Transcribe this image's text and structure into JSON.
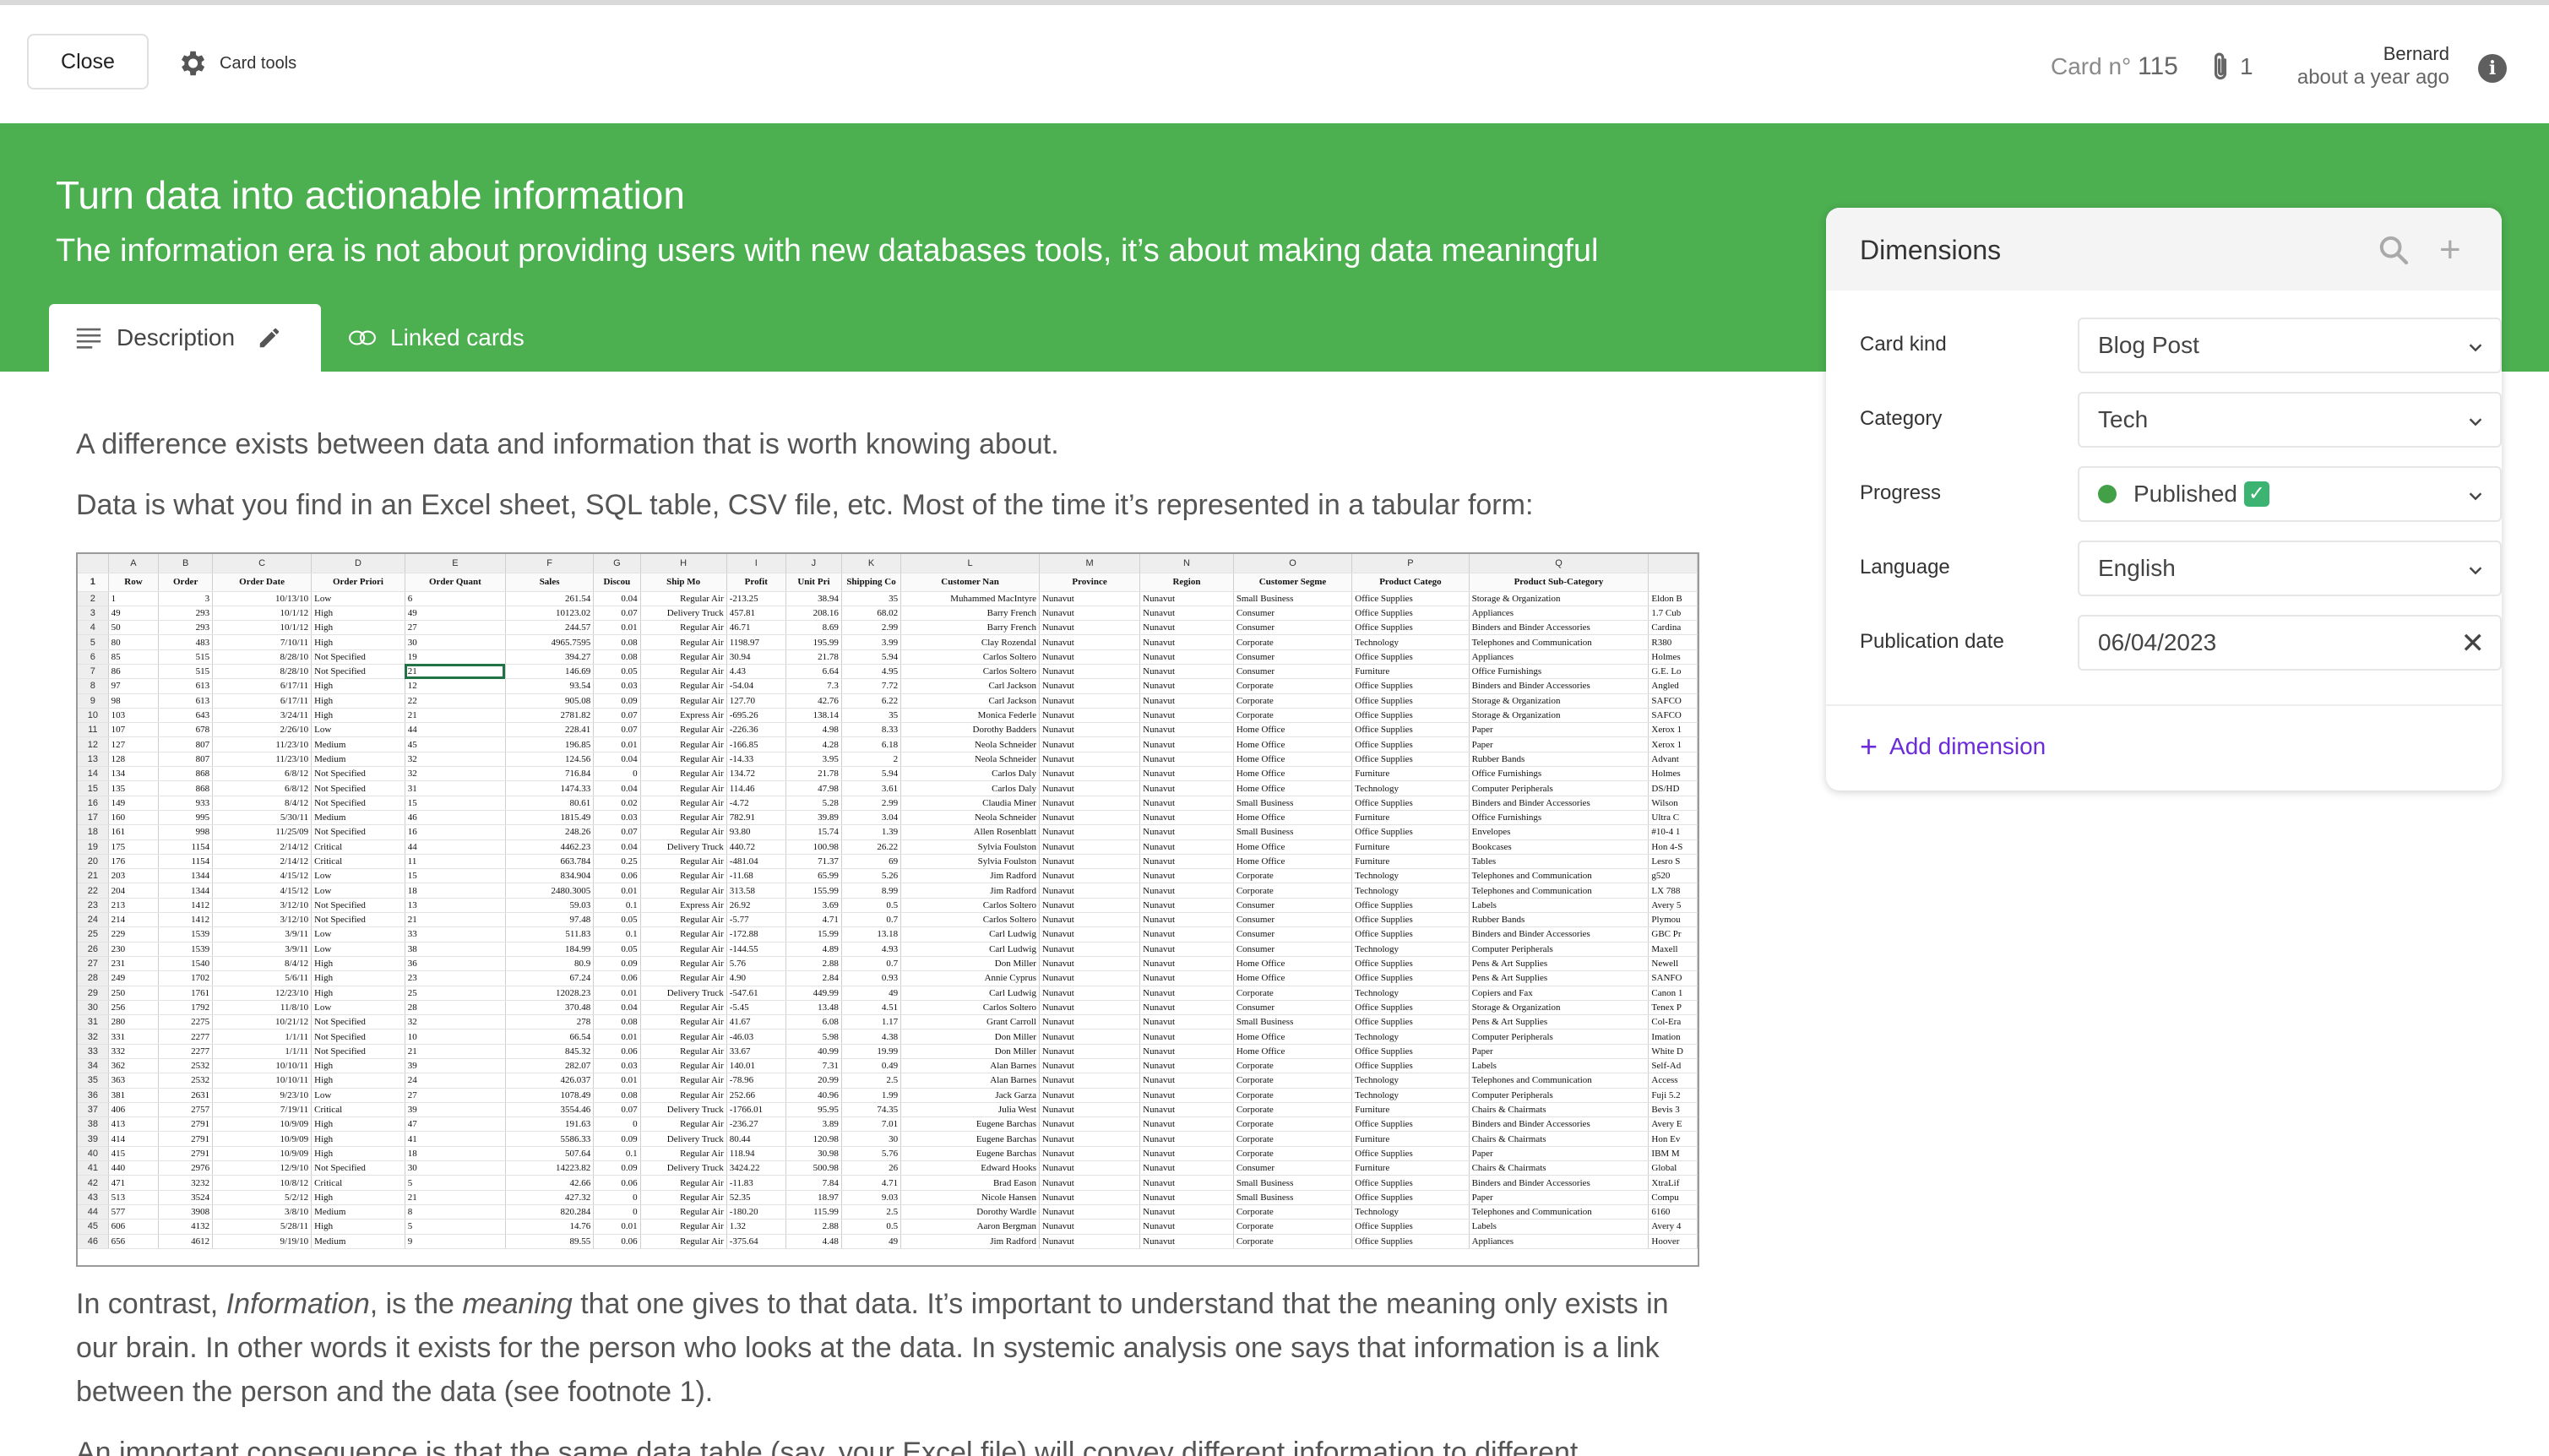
{
  "topbar": {
    "close_label": "Close",
    "card_tools_label": "Card tools",
    "card_number_label": "Card n°",
    "card_number": "115",
    "attachments_count": "1",
    "author": "Bernard",
    "updated": "about a year ago"
  },
  "hero": {
    "title": "Turn data into actionable information",
    "subtitle": "The information era is not about providing users with new databases tools, it’s about making data meaningful",
    "tabs": {
      "description": "Description",
      "linked": "Linked cards"
    },
    "bg_color": "#4caf50"
  },
  "content": {
    "p1": "A difference exists between data and information that is worth knowing about.",
    "p2": "Data is what you find in an Excel sheet, SQL table, CSV file, etc. Most of the time it’s represented in a tabular form:",
    "p3_a": "In contrast, ",
    "p3_b": "Information",
    "p3_c": ", is the ",
    "p3_d": "meaning",
    "p3_e": " that one gives to that data. It’s important to understand that the meaning only exists in our brain. In other words it exists for the person who looks at the data. In systemic analysis one says that information is a link between the person and the data (see footnote 1).",
    "p4": "An important consequence is that the same data table (say, your Excel file) will convey different information to different"
  },
  "spreadsheet": {
    "columns": [
      "A",
      "B",
      "C",
      "D",
      "E",
      "F",
      "G",
      "H",
      "I",
      "J",
      "K",
      "L",
      "M",
      "N",
      "O",
      "P",
      "Q",
      ""
    ],
    "fields": [
      "Row",
      "Order",
      "Order Date",
      "Order Priori",
      "Order Quant",
      "Sales",
      "Discou",
      "Ship Mo",
      "Profit",
      "Unit Pri",
      "Shipping Co",
      "Customer Nan",
      "Province",
      "Region",
      "Customer Segme",
      "Product Catego",
      "Product Sub-Category",
      ""
    ],
    "rows": [
      [
        "1",
        "3",
        "10/13/10",
        "Low",
        "6",
        "261.54",
        "0.04",
        "Regular Air",
        "-213.25",
        "38.94",
        "35",
        "Muhammed MacIntyre",
        "Nunavut",
        "Nunavut",
        "Small Business",
        "Office Supplies",
        "Storage & Organization",
        "Eldon B"
      ],
      [
        "49",
        "293",
        "10/1/12",
        "High",
        "49",
        "10123.02",
        "0.07",
        "Delivery Truck",
        "457.81",
        "208.16",
        "68.02",
        "Barry French",
        "Nunavut",
        "Nunavut",
        "Consumer",
        "Office Supplies",
        "Appliances",
        "1.7 Cub"
      ],
      [
        "50",
        "293",
        "10/1/12",
        "High",
        "27",
        "244.57",
        "0.01",
        "Regular Air",
        "46.71",
        "8.69",
        "2.99",
        "Barry French",
        "Nunavut",
        "Nunavut",
        "Consumer",
        "Office Supplies",
        "Binders and Binder Accessories",
        "Cardina"
      ],
      [
        "80",
        "483",
        "7/10/11",
        "High",
        "30",
        "4965.7595",
        "0.08",
        "Regular Air",
        "1198.97",
        "195.99",
        "3.99",
        "Clay Rozendal",
        "Nunavut",
        "Nunavut",
        "Corporate",
        "Technology",
        "Telephones and Communication",
        "R380"
      ],
      [
        "85",
        "515",
        "8/28/10",
        "Not Specified",
        "19",
        "394.27",
        "0.08",
        "Regular Air",
        "30.94",
        "21.78",
        "5.94",
        "Carlos Soltero",
        "Nunavut",
        "Nunavut",
        "Consumer",
        "Office Supplies",
        "Appliances",
        "Holmes"
      ],
      [
        "86",
        "515",
        "8/28/10",
        "Not Specified",
        "21",
        "146.69",
        "0.05",
        "Regular Air",
        "4.43",
        "6.64",
        "4.95",
        "Carlos Soltero",
        "Nunavut",
        "Nunavut",
        "Consumer",
        "Furniture",
        "Office Furnishings",
        "G.E. Lo"
      ],
      [
        "97",
        "613",
        "6/17/11",
        "High",
        "12",
        "93.54",
        "0.03",
        "Regular Air",
        "-54.04",
        "7.3",
        "7.72",
        "Carl Jackson",
        "Nunavut",
        "Nunavut",
        "Corporate",
        "Office Supplies",
        "Binders and Binder Accessories",
        "Angled"
      ],
      [
        "98",
        "613",
        "6/17/11",
        "High",
        "22",
        "905.08",
        "0.09",
        "Regular Air",
        "127.70",
        "42.76",
        "6.22",
        "Carl Jackson",
        "Nunavut",
        "Nunavut",
        "Corporate",
        "Office Supplies",
        "Storage & Organization",
        "SAFCO"
      ],
      [
        "103",
        "643",
        "3/24/11",
        "High",
        "21",
        "2781.82",
        "0.07",
        "Express Air",
        "-695.26",
        "138.14",
        "35",
        "Monica Federle",
        "Nunavut",
        "Nunavut",
        "Corporate",
        "Office Supplies",
        "Storage & Organization",
        "SAFCO"
      ],
      [
        "107",
        "678",
        "2/26/10",
        "Low",
        "44",
        "228.41",
        "0.07",
        "Regular Air",
        "-226.36",
        "4.98",
        "8.33",
        "Dorothy Badders",
        "Nunavut",
        "Nunavut",
        "Home Office",
        "Office Supplies",
        "Paper",
        "Xerox 1"
      ],
      [
        "127",
        "807",
        "11/23/10",
        "Medium",
        "45",
        "196.85",
        "0.01",
        "Regular Air",
        "-166.85",
        "4.28",
        "6.18",
        "Neola Schneider",
        "Nunavut",
        "Nunavut",
        "Home Office",
        "Office Supplies",
        "Paper",
        "Xerox 1"
      ],
      [
        "128",
        "807",
        "11/23/10",
        "Medium",
        "32",
        "124.56",
        "0.04",
        "Regular Air",
        "-14.33",
        "3.95",
        "2",
        "Neola Schneider",
        "Nunavut",
        "Nunavut",
        "Home Office",
        "Office Supplies",
        "Rubber Bands",
        "Advant"
      ],
      [
        "134",
        "868",
        "6/8/12",
        "Not Specified",
        "32",
        "716.84",
        "0",
        "Regular Air",
        "134.72",
        "21.78",
        "5.94",
        "Carlos Daly",
        "Nunavut",
        "Nunavut",
        "Home Office",
        "Furniture",
        "Office Furnishings",
        "Holmes"
      ],
      [
        "135",
        "868",
        "6/8/12",
        "Not Specified",
        "31",
        "1474.33",
        "0.04",
        "Regular Air",
        "114.46",
        "47.98",
        "3.61",
        "Carlos Daly",
        "Nunavut",
        "Nunavut",
        "Home Office",
        "Technology",
        "Computer Peripherals",
        "DS/HD"
      ],
      [
        "149",
        "933",
        "8/4/12",
        "Not Specified",
        "15",
        "80.61",
        "0.02",
        "Regular Air",
        "-4.72",
        "5.28",
        "2.99",
        "Claudia Miner",
        "Nunavut",
        "Nunavut",
        "Small Business",
        "Office Supplies",
        "Binders and Binder Accessories",
        "Wilson"
      ],
      [
        "160",
        "995",
        "5/30/11",
        "Medium",
        "46",
        "1815.49",
        "0.03",
        "Regular Air",
        "782.91",
        "39.89",
        "3.04",
        "Neola Schneider",
        "Nunavut",
        "Nunavut",
        "Home Office",
        "Furniture",
        "Office Furnishings",
        "Ultra C"
      ],
      [
        "161",
        "998",
        "11/25/09",
        "Not Specified",
        "16",
        "248.26",
        "0.07",
        "Regular Air",
        "93.80",
        "15.74",
        "1.39",
        "Allen Rosenblatt",
        "Nunavut",
        "Nunavut",
        "Small Business",
        "Office Supplies",
        "Envelopes",
        "#10-4 1"
      ],
      [
        "175",
        "1154",
        "2/14/12",
        "Critical",
        "44",
        "4462.23",
        "0.04",
        "Delivery Truck",
        "440.72",
        "100.98",
        "26.22",
        "Sylvia Foulston",
        "Nunavut",
        "Nunavut",
        "Home Office",
        "Furniture",
        "Bookcases",
        "Hon 4-S"
      ],
      [
        "176",
        "1154",
        "2/14/12",
        "Critical",
        "11",
        "663.784",
        "0.25",
        "Regular Air",
        "-481.04",
        "71.37",
        "69",
        "Sylvia Foulston",
        "Nunavut",
        "Nunavut",
        "Home Office",
        "Furniture",
        "Tables",
        "Lesro S"
      ],
      [
        "203",
        "1344",
        "4/15/12",
        "Low",
        "15",
        "834.904",
        "0.06",
        "Regular Air",
        "-11.68",
        "65.99",
        "5.26",
        "Jim Radford",
        "Nunavut",
        "Nunavut",
        "Corporate",
        "Technology",
        "Telephones and Communication",
        "g520"
      ],
      [
        "204",
        "1344",
        "4/15/12",
        "Low",
        "18",
        "2480.3005",
        "0.01",
        "Regular Air",
        "313.58",
        "155.99",
        "8.99",
        "Jim Radford",
        "Nunavut",
        "Nunavut",
        "Corporate",
        "Technology",
        "Telephones and Communication",
        "LX 788"
      ],
      [
        "213",
        "1412",
        "3/12/10",
        "Not Specified",
        "13",
        "59.03",
        "0.1",
        "Express Air",
        "26.92",
        "3.69",
        "0.5",
        "Carlos Soltero",
        "Nunavut",
        "Nunavut",
        "Consumer",
        "Office Supplies",
        "Labels",
        "Avery 5"
      ],
      [
        "214",
        "1412",
        "3/12/10",
        "Not Specified",
        "21",
        "97.48",
        "0.05",
        "Regular Air",
        "-5.77",
        "4.71",
        "0.7",
        "Carlos Soltero",
        "Nunavut",
        "Nunavut",
        "Consumer",
        "Office Supplies",
        "Rubber Bands",
        "Plymou"
      ],
      [
        "229",
        "1539",
        "3/9/11",
        "Low",
        "33",
        "511.83",
        "0.1",
        "Regular Air",
        "-172.88",
        "15.99",
        "13.18",
        "Carl Ludwig",
        "Nunavut",
        "Nunavut",
        "Consumer",
        "Office Supplies",
        "Binders and Binder Accessories",
        "GBC Pr"
      ],
      [
        "230",
        "1539",
        "3/9/11",
        "Low",
        "38",
        "184.99",
        "0.05",
        "Regular Air",
        "-144.55",
        "4.89",
        "4.93",
        "Carl Ludwig",
        "Nunavut",
        "Nunavut",
        "Consumer",
        "Technology",
        "Computer Peripherals",
        "Maxell"
      ],
      [
        "231",
        "1540",
        "8/4/12",
        "High",
        "36",
        "80.9",
        "0.09",
        "Regular Air",
        "5.76",
        "2.88",
        "0.7",
        "Don Miller",
        "Nunavut",
        "Nunavut",
        "Home Office",
        "Office Supplies",
        "Pens & Art Supplies",
        "Newell"
      ],
      [
        "249",
        "1702",
        "5/6/11",
        "High",
        "23",
        "67.24",
        "0.06",
        "Regular Air",
        "4.90",
        "2.84",
        "0.93",
        "Annie Cyprus",
        "Nunavut",
        "Nunavut",
        "Home Office",
        "Office Supplies",
        "Pens & Art Supplies",
        "SANFO"
      ],
      [
        "250",
        "1761",
        "12/23/10",
        "High",
        "25",
        "12028.23",
        "0.01",
        "Delivery Truck",
        "-547.61",
        "449.99",
        "49",
        "Carl Ludwig",
        "Nunavut",
        "Nunavut",
        "Corporate",
        "Technology",
        "Copiers and Fax",
        "Canon 1"
      ],
      [
        "256",
        "1792",
        "11/8/10",
        "Low",
        "28",
        "370.48",
        "0.04",
        "Regular Air",
        "-5.45",
        "13.48",
        "4.51",
        "Carlos Soltero",
        "Nunavut",
        "Nunavut",
        "Consumer",
        "Office Supplies",
        "Storage & Organization",
        "Tenex P"
      ],
      [
        "280",
        "2275",
        "10/21/12",
        "Not Specified",
        "32",
        "278",
        "0.08",
        "Regular Air",
        "41.67",
        "6.08",
        "1.17",
        "Grant Carroll",
        "Nunavut",
        "Nunavut",
        "Small Business",
        "Office Supplies",
        "Pens & Art Supplies",
        "Col-Era"
      ],
      [
        "331",
        "2277",
        "1/1/11",
        "Not Specified",
        "10",
        "66.54",
        "0.01",
        "Regular Air",
        "-46.03",
        "5.98",
        "4.38",
        "Don Miller",
        "Nunavut",
        "Nunavut",
        "Home Office",
        "Technology",
        "Computer Peripherals",
        "Imation"
      ],
      [
        "332",
        "2277",
        "1/1/11",
        "Not Specified",
        "21",
        "845.32",
        "0.06",
        "Regular Air",
        "33.67",
        "40.99",
        "19.99",
        "Don Miller",
        "Nunavut",
        "Nunavut",
        "Home Office",
        "Office Supplies",
        "Paper",
        "White D"
      ],
      [
        "362",
        "2532",
        "10/10/11",
        "High",
        "39",
        "282.07",
        "0.03",
        "Regular Air",
        "140.01",
        "7.31",
        "0.49",
        "Alan Barnes",
        "Nunavut",
        "Nunavut",
        "Corporate",
        "Office Supplies",
        "Labels",
        "Self-Ad"
      ],
      [
        "363",
        "2532",
        "10/10/11",
        "High",
        "24",
        "426.037",
        "0.01",
        "Regular Air",
        "-78.96",
        "20.99",
        "2.5",
        "Alan Barnes",
        "Nunavut",
        "Nunavut",
        "Corporate",
        "Technology",
        "Telephones and Communication",
        "Access"
      ],
      [
        "381",
        "2631",
        "9/23/10",
        "Low",
        "27",
        "1078.49",
        "0.08",
        "Regular Air",
        "252.66",
        "40.96",
        "1.99",
        "Jack Garza",
        "Nunavut",
        "Nunavut",
        "Corporate",
        "Technology",
        "Computer Peripherals",
        "Fuji 5.2"
      ],
      [
        "406",
        "2757",
        "7/19/11",
        "Critical",
        "39",
        "3554.46",
        "0.07",
        "Delivery Truck",
        "-1766.01",
        "95.95",
        "74.35",
        "Julia West",
        "Nunavut",
        "Nunavut",
        "Corporate",
        "Furniture",
        "Chairs & Chairmats",
        "Bevis 3"
      ],
      [
        "413",
        "2791",
        "10/9/09",
        "High",
        "47",
        "191.63",
        "0",
        "Regular Air",
        "-236.27",
        "3.89",
        "7.01",
        "Eugene Barchas",
        "Nunavut",
        "Nunavut",
        "Corporate",
        "Office Supplies",
        "Binders and Binder Accessories",
        "Avery E"
      ],
      [
        "414",
        "2791",
        "10/9/09",
        "High",
        "41",
        "5586.33",
        "0.09",
        "Delivery Truck",
        "80.44",
        "120.98",
        "30",
        "Eugene Barchas",
        "Nunavut",
        "Nunavut",
        "Corporate",
        "Furniture",
        "Chairs & Chairmats",
        "Hon Ev"
      ],
      [
        "415",
        "2791",
        "10/9/09",
        "High",
        "18",
        "507.64",
        "0.1",
        "Regular Air",
        "118.94",
        "30.98",
        "5.76",
        "Eugene Barchas",
        "Nunavut",
        "Nunavut",
        "Corporate",
        "Office Supplies",
        "Paper",
        "IBM M"
      ],
      [
        "440",
        "2976",
        "12/9/10",
        "Not Specified",
        "30",
        "14223.82",
        "0.09",
        "Delivery Truck",
        "3424.22",
        "500.98",
        "26",
        "Edward Hooks",
        "Nunavut",
        "Nunavut",
        "Consumer",
        "Furniture",
        "Chairs & Chairmats",
        "Global"
      ],
      [
        "471",
        "3232",
        "10/8/12",
        "Critical",
        "5",
        "42.66",
        "0.06",
        "Regular Air",
        "-11.83",
        "7.84",
        "4.71",
        "Brad Eason",
        "Nunavut",
        "Nunavut",
        "Small Business",
        "Office Supplies",
        "Binders and Binder Accessories",
        "XtraLif"
      ],
      [
        "513",
        "3524",
        "5/2/12",
        "High",
        "21",
        "427.32",
        "0",
        "Regular Air",
        "52.35",
        "18.97",
        "9.03",
        "Nicole Hansen",
        "Nunavut",
        "Nunavut",
        "Small Business",
        "Office Supplies",
        "Paper",
        "Compu"
      ],
      [
        "577",
        "3908",
        "3/8/10",
        "Medium",
        "8",
        "820.284",
        "0",
        "Regular Air",
        "-180.20",
        "115.99",
        "2.5",
        "Dorothy Wardle",
        "Nunavut",
        "Nunavut",
        "Corporate",
        "Technology",
        "Telephones and Communication",
        "6160"
      ],
      [
        "606",
        "4132",
        "5/28/11",
        "High",
        "5",
        "14.76",
        "0.01",
        "Regular Air",
        "1.32",
        "2.88",
        "0.5",
        "Aaron Bergman",
        "Nunavut",
        "Nunavut",
        "Corporate",
        "Office Supplies",
        "Labels",
        "Avery 4"
      ],
      [
        "656",
        "4612",
        "9/19/10",
        "Medium",
        "9",
        "89.55",
        "0.06",
        "Regular Air",
        "-375.64",
        "4.48",
        "49",
        "Jim Radford",
        "Nunavut",
        "Nunavut",
        "Corporate",
        "Office Supplies",
        "Appliances",
        "Hoover"
      ]
    ]
  },
  "panel": {
    "title": "Dimensions",
    "dims": [
      {
        "label": "Card kind",
        "value": "Blog Post"
      },
      {
        "label": "Category",
        "value": "Tech"
      },
      {
        "label": "Progress",
        "value": "Published"
      },
      {
        "label": "Language",
        "value": "English"
      },
      {
        "label": "Publication date",
        "value": "06/04/2023"
      }
    ],
    "add_label": "Add dimension",
    "status_color": "#43a047",
    "link_color": "#6b2bd9"
  }
}
